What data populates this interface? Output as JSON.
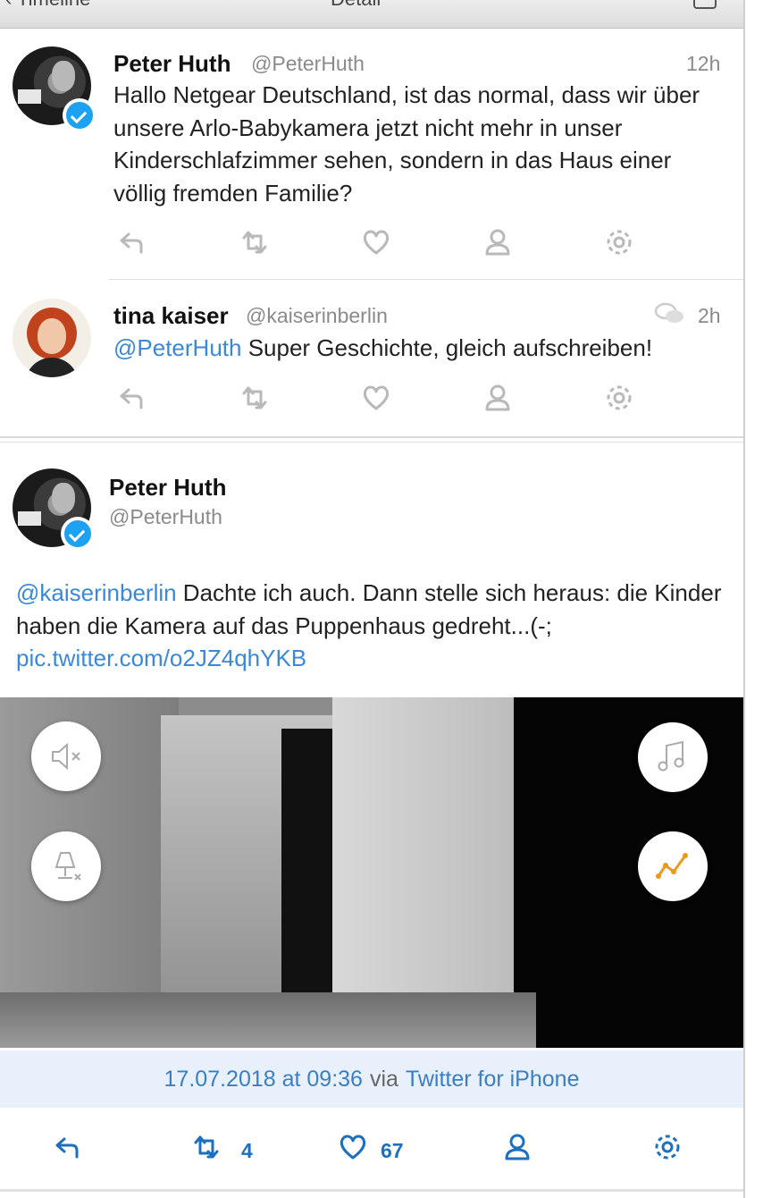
{
  "titlebar": {
    "back_label": "Timeline",
    "title": "Detail"
  },
  "tweets": [
    {
      "name": "Peter Huth",
      "handle": "@PeterHuth",
      "time": "12h",
      "text": "Hallo Netgear Deutschland, ist das normal, dass wir über unsere Arlo-Babykamera jetzt nicht mehr in unser Kinderschlafzimmer sehen, sondern in das Haus einer völlig fremden Familie?",
      "verified": true
    },
    {
      "name": "tina kaiser",
      "handle": "@kaiserinberlin",
      "time": "2h",
      "mention": "@PeterHuth",
      "text": " Super Geschichte, gleich aufschreiben!",
      "verified": false
    }
  ],
  "detail": {
    "name": "Peter Huth",
    "handle": "@PeterHuth",
    "mention": "@kaiserinberlin",
    "text": " Dachte ich auch. Dann stelle sich heraus: die Kinder haben die Kamera auf das Puppenhaus gedreht...(-; ",
    "link": "pic.twitter.com/o2JZ4qhYKB",
    "date": "17.07.2018 at 09:36",
    "via": "via",
    "client": "Twitter for iPhone",
    "retweets": "4",
    "likes": "67"
  },
  "colors": {
    "link": "#3a88d6",
    "action_active": "#1d6fc0",
    "meta_bg": "#e8f1fb"
  },
  "icons": [
    "reply-icon",
    "retweet-icon",
    "like-icon",
    "profile-icon",
    "gear-icon",
    "conversation-icon",
    "mute-icon",
    "lamp-off-icon",
    "music-icon",
    "graph-icon",
    "verified-badge-icon"
  ]
}
